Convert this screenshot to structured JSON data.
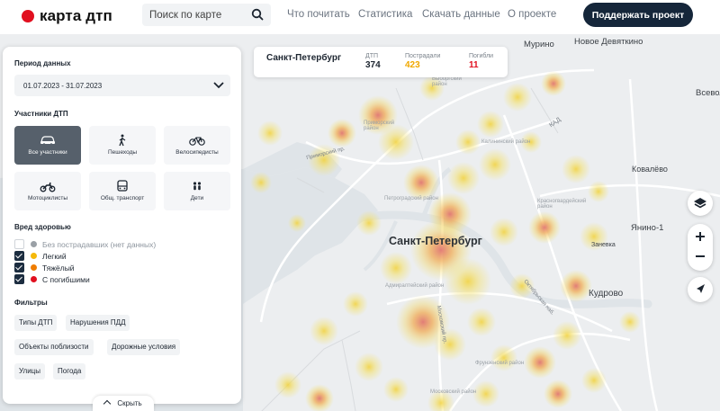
{
  "header": {
    "logo_text": "карта дтп",
    "brand_color": "#e10f1f",
    "search_placeholder": "Поиск по карте",
    "nav": [
      "Что почитать",
      "Статистика",
      "Скачать данные",
      "О проекте"
    ],
    "support_button": "Поддержать проект"
  },
  "panel": {
    "period_title": "Период данных",
    "period_value": "01.07.2023 - 31.07.2023",
    "participants_title": "Участники ДТП",
    "participants": [
      {
        "label": "Все участники",
        "icon": "car-icon",
        "active": true
      },
      {
        "label": "Пешеходы",
        "icon": "pedestrian-icon",
        "active": false
      },
      {
        "label": "Велосипедисты",
        "icon": "bicycle-icon",
        "active": false
      },
      {
        "label": "Мотоциклисты",
        "icon": "motorcycle-icon",
        "active": false
      },
      {
        "label": "Общ. транспорт",
        "icon": "bus-icon",
        "active": false
      },
      {
        "label": "Дети",
        "icon": "children-icon",
        "active": false
      }
    ],
    "harm_title": "Вред здоровью",
    "harm": [
      {
        "label": "Без пострадавших (нет данных)",
        "color": "#9aa0a6",
        "checked": false
      },
      {
        "label": "Легкий",
        "color": "#f5b90a",
        "checked": true
      },
      {
        "label": "Тяжёлый",
        "color": "#ef7d00",
        "checked": true
      },
      {
        "label": "С погибшими",
        "color": "#e10f1f",
        "checked": true
      }
    ],
    "filters_title": "Фильтры",
    "filters": [
      "Типы ДТП",
      "Нарушения ПДД",
      "Объекты поблизости",
      "Дорожные условия",
      "Улицы",
      "Погода"
    ],
    "hide_label": "Скрыть"
  },
  "city_card": {
    "name": "Санкт-Петербург",
    "stats": [
      {
        "label": "ДТП",
        "value": "374",
        "color": "#1c2530"
      },
      {
        "label": "Пострадали",
        "value": "423",
        "color": "#f0a800"
      },
      {
        "label": "Погибли",
        "value": "11",
        "color": "#e10f1f"
      }
    ]
  },
  "map": {
    "city_label": "Санкт-Петербург",
    "places": [
      "Мурино",
      "Новое Девяткино",
      "Всеволожск",
      "Ковалёво",
      "Янино-1",
      "Заневка",
      "Кудрово"
    ],
    "districts": [
      "Приморский район",
      "Выборгский район",
      "Калининский район",
      "Петроградский район",
      "Красногвардейский район",
      "Адмиралтейский район",
      "Фрунзенский район",
      "Московский район"
    ],
    "roads": [
      "Приморский пр.",
      "пр. Испытателей",
      "пр. Просвещения",
      "Кондратьевский пр.",
      "Московский пр.",
      "пр. Славы",
      "Октябрьская наб.",
      "КАД"
    ]
  },
  "controls": {
    "layers_icon": "layers-icon",
    "zoom_in_icon": "plus-icon",
    "zoom_out_icon": "minus-icon",
    "locate_icon": "navigation-arrow-icon"
  }
}
